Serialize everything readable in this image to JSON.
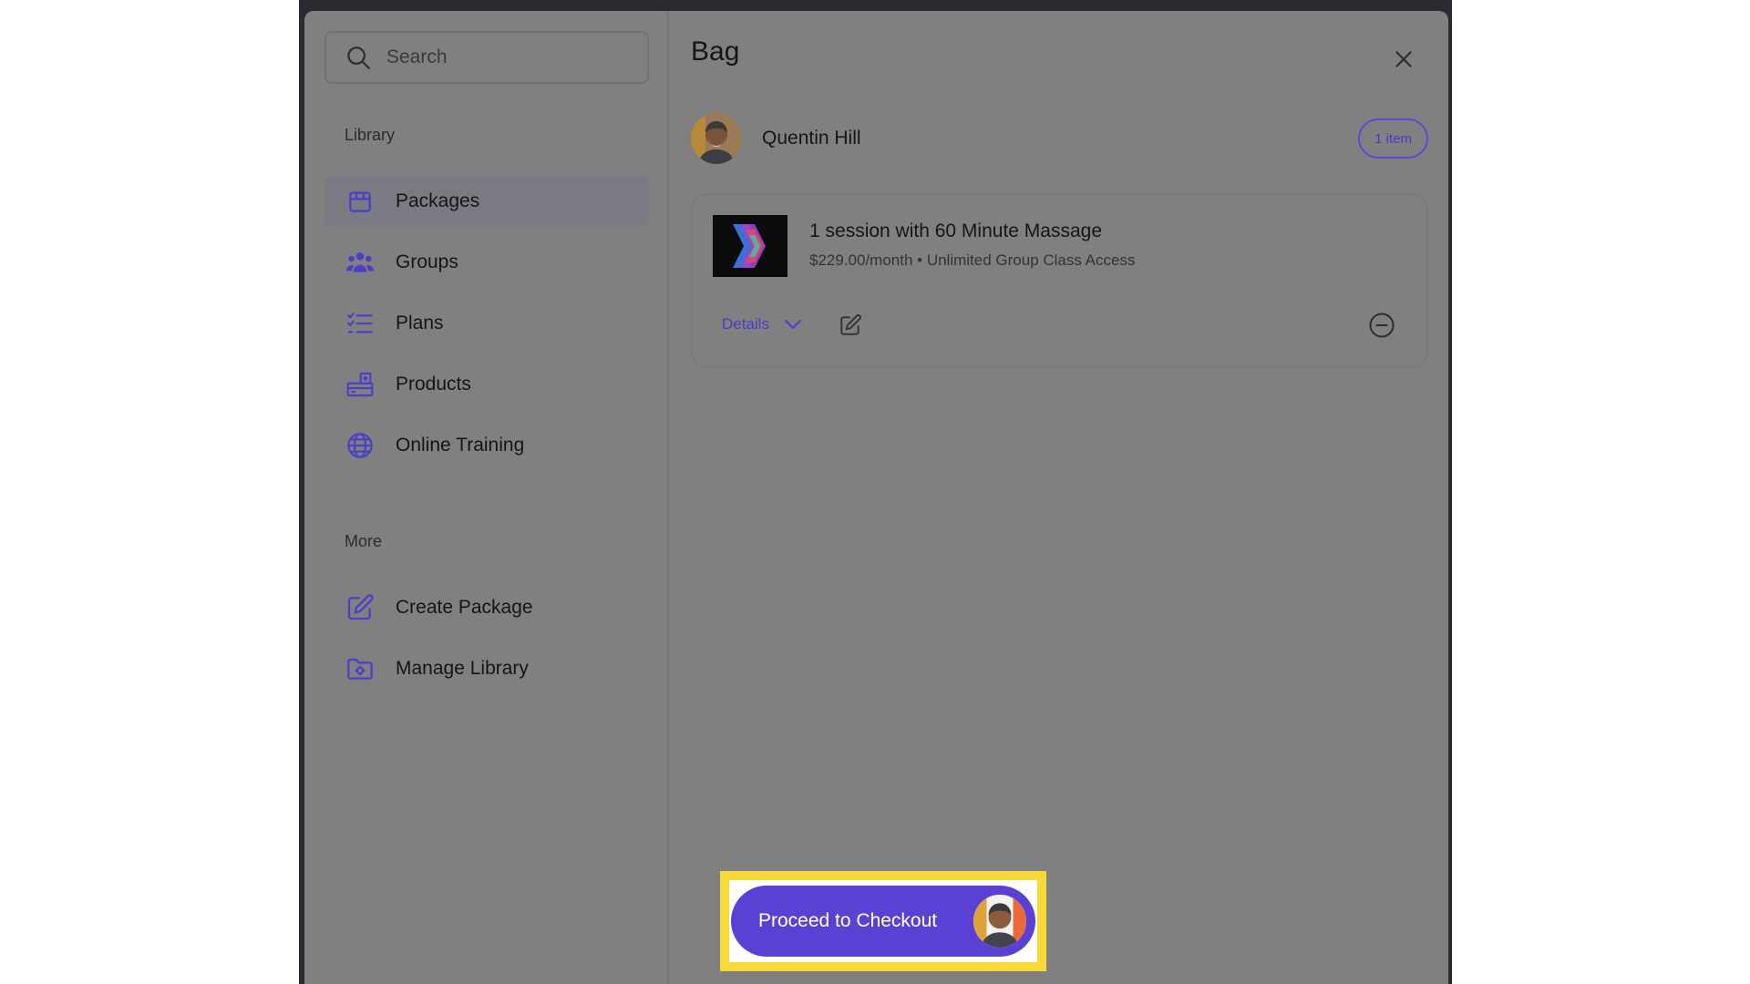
{
  "search": {
    "placeholder": "Search"
  },
  "sidebar": {
    "library_label": "Library",
    "library_items": [
      {
        "label": "Packages",
        "icon": "package-icon",
        "active": true
      },
      {
        "label": "Groups",
        "icon": "groups-icon"
      },
      {
        "label": "Plans",
        "icon": "list-icon"
      },
      {
        "label": "Products",
        "icon": "products-icon"
      },
      {
        "label": "Online Training",
        "icon": "globe-icon"
      }
    ],
    "more_label": "More",
    "more_items": [
      {
        "label": "Create Package",
        "icon": "edit-icon"
      },
      {
        "label": "Manage Library",
        "icon": "folder-settings-icon"
      }
    ]
  },
  "bag": {
    "title": "Bag",
    "client": {
      "name": "Quentin Hill"
    },
    "item_count": "1 item",
    "items": [
      {
        "title": "1 session with 60 Minute Massage",
        "subtitle": "$229.00/month • Unlimited Group Class Access",
        "details_label": "Details"
      }
    ],
    "checkout_label": "Proceed to Checkout"
  },
  "colors": {
    "accent": "#5b40d4",
    "link": "#4a3ec4",
    "highlight": "#f7d93a",
    "overlay": "#808080"
  }
}
